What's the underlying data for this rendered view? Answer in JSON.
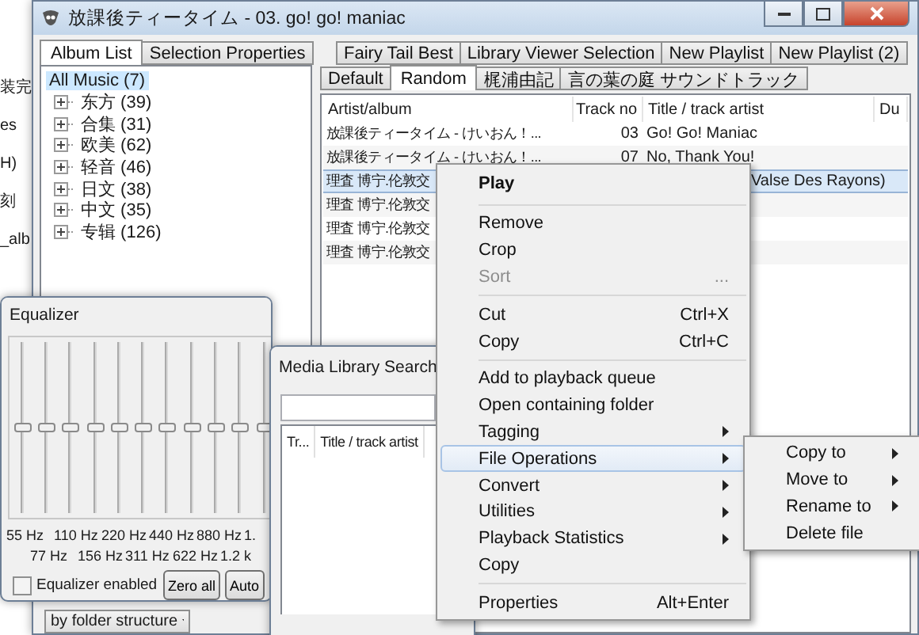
{
  "background_window": {
    "fragments": [
      "装完",
      "es",
      "H)",
      "刻",
      "_alb"
    ]
  },
  "main_window": {
    "title": "放課後ティータイム - 03. go! go! maniac",
    "left_tabs": [
      {
        "label": "Album List",
        "selected": true
      },
      {
        "label": "Selection Properties",
        "selected": false
      }
    ],
    "tree": [
      {
        "label": "All Music (7)",
        "selected": true
      },
      {
        "label": "东方 (39)",
        "selected": false,
        "expanded": false
      },
      {
        "label": "合集 (31)",
        "selected": false,
        "expanded": false
      },
      {
        "label": "欧美 (62)",
        "selected": false,
        "expanded": false
      },
      {
        "label": "轻音 (46)",
        "selected": false,
        "expanded": false
      },
      {
        "label": "日文 (38)",
        "selected": false,
        "expanded": false
      },
      {
        "label": "中文 (35)",
        "selected": false,
        "expanded": false
      },
      {
        "label": "专辑 (126)",
        "selected": false,
        "expanded": false
      }
    ],
    "view_dropdown": "by folder structure",
    "playlist_tabs": [
      [
        {
          "label": "Fairy Tail Best",
          "selected": false
        },
        {
          "label": "Library Viewer Selection",
          "selected": false
        },
        {
          "label": "New Playlist",
          "selected": false
        },
        {
          "label": "New Playlist (2)",
          "selected": false
        }
      ],
      [
        {
          "label": "Default",
          "selected": false
        },
        {
          "label": "Random",
          "selected": true
        },
        {
          "label": "梶浦由記",
          "selected": false
        },
        {
          "label": "言の葉の庭 サウンドトラック",
          "selected": false
        }
      ]
    ],
    "columns": [
      "Artist/album",
      "Track no",
      "Title / track artist",
      "Du"
    ],
    "rows": [
      {
        "artist": "放課後ティータイム - けいおん！...",
        "track": "03",
        "title": "Go! Go! Maniac",
        "selected": false
      },
      {
        "artist": "放課後ティータイム - けいおん！...",
        "track": "07",
        "title": "No, Thank You!",
        "selected": false
      },
      {
        "artist": "理査 博宁.伦敦交",
        "title": "Valse Des Rayons)",
        "selected": true
      },
      {
        "artist": "理査 博宁.伦敦交",
        "selected": false
      },
      {
        "artist": "理査 博宁.伦敦交",
        "selected": false
      },
      {
        "artist": "理査 博宁.伦敦交",
        "selected": false
      }
    ]
  },
  "equalizer": {
    "title": "Equalizer",
    "sliders": [
      {
        "level": 0.5
      },
      {
        "level": 0.5
      },
      {
        "level": 0.5
      },
      {
        "level": 0.5
      },
      {
        "level": 0.5
      },
      {
        "level": 0.5
      },
      {
        "level": 0.5
      },
      {
        "level": 0.5
      },
      {
        "level": 0.5
      },
      {
        "level": 0.5
      },
      {
        "level": 0.5
      }
    ],
    "label_rows": [
      [
        "55 Hz",
        "110 Hz",
        "220 Hz",
        "440 Hz",
        "880 Hz",
        "1."
      ],
      [
        "77 Hz",
        "156 Hz",
        "311 Hz",
        "622 Hz",
        "1.2 k"
      ]
    ],
    "enabled": false,
    "enabled_label": "Equalizer enabled",
    "buttons": [
      "Zero all",
      "Auto"
    ]
  },
  "media_search": {
    "title": "Media Library Search",
    "columns": [
      "Tr...",
      "Title / track artist"
    ]
  },
  "context_menu": [
    {
      "kind": "item",
      "label": "Play",
      "bold": true
    },
    {
      "kind": "separator"
    },
    {
      "kind": "item",
      "label": "Remove"
    },
    {
      "kind": "item",
      "label": "Crop"
    },
    {
      "kind": "item",
      "label": "Sort",
      "disabled": true,
      "shortcut": "..."
    },
    {
      "kind": "separator"
    },
    {
      "kind": "item",
      "label": "Cut",
      "shortcut": "Ctrl+X"
    },
    {
      "kind": "item",
      "label": "Copy",
      "shortcut": "Ctrl+C"
    },
    {
      "kind": "separator"
    },
    {
      "kind": "item",
      "label": "Add to playback queue"
    },
    {
      "kind": "item",
      "label": "Open containing folder"
    },
    {
      "kind": "item",
      "label": "Tagging",
      "submenu": true
    },
    {
      "kind": "item",
      "label": "File Operations",
      "submenu": true,
      "highlighted": true
    },
    {
      "kind": "item",
      "label": "Convert",
      "submenu": true
    },
    {
      "kind": "item",
      "label": "Utilities",
      "submenu": true
    },
    {
      "kind": "item",
      "label": "Playback Statistics",
      "submenu": true
    },
    {
      "kind": "item",
      "label": "Copy"
    },
    {
      "kind": "separator"
    },
    {
      "kind": "item",
      "label": "Properties",
      "shortcut": "Alt+Enter"
    }
  ],
  "submenu": [
    {
      "kind": "item",
      "label": "Copy to",
      "submenu": true
    },
    {
      "kind": "item",
      "label": "Move to",
      "submenu": true
    },
    {
      "kind": "item",
      "label": "Rename to",
      "submenu": true
    },
    {
      "kind": "item",
      "label": "Delete file"
    }
  ]
}
